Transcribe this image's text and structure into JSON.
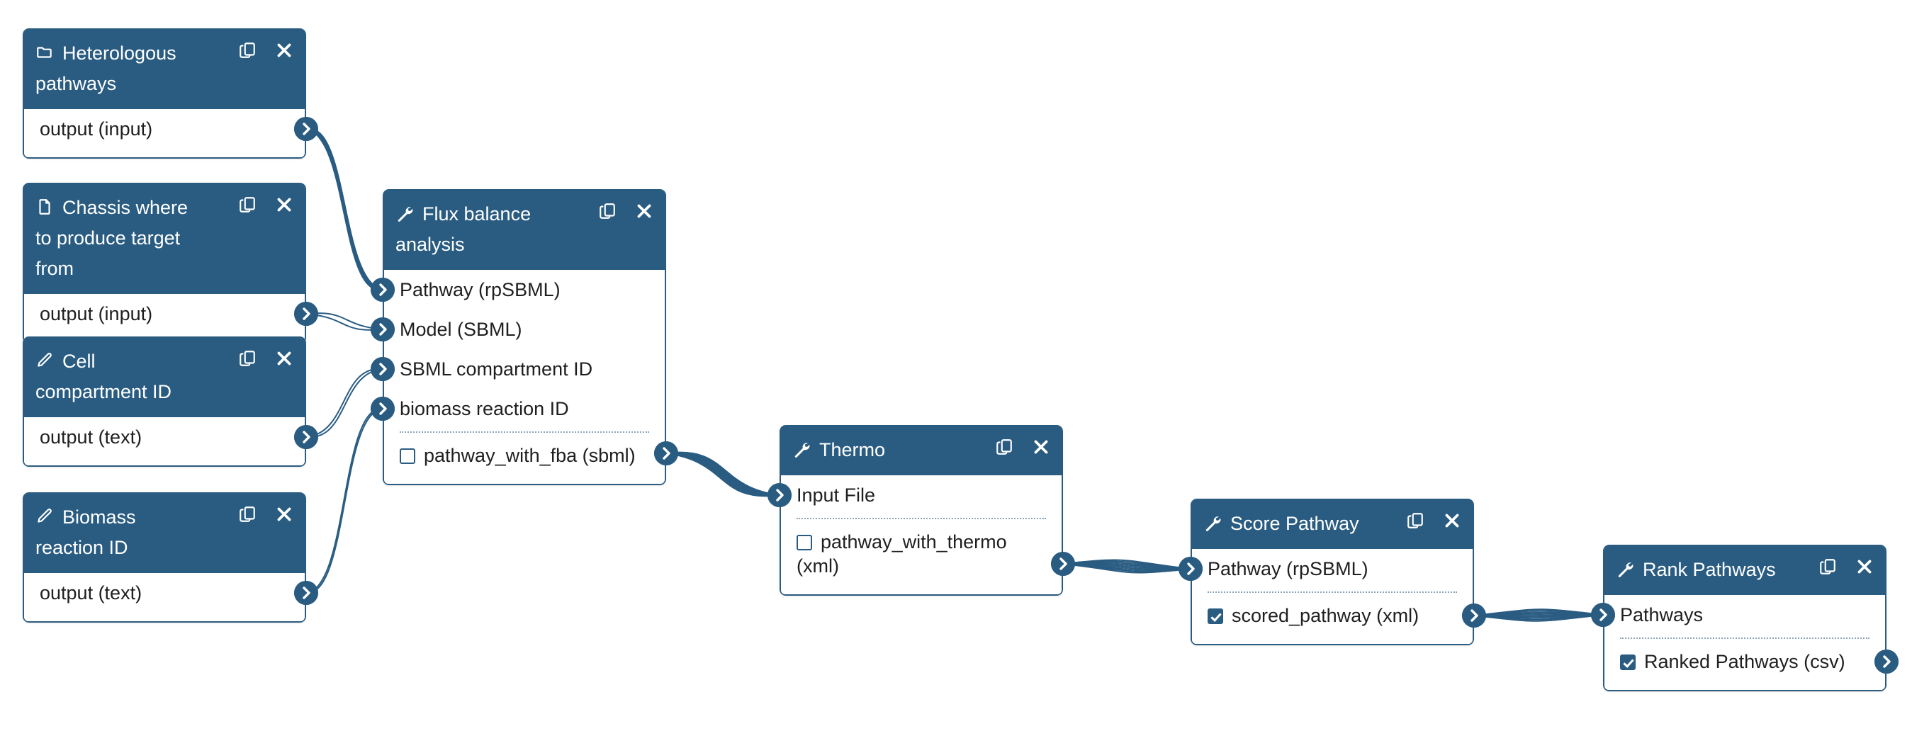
{
  "app": {
    "title": "Workflow Editor Canvas",
    "colors": {
      "node_header": "#2a5c82",
      "node_border": "#2a5c82",
      "node_body": "#ffffff",
      "edge": "#2a5c82",
      "port": "#2a5c82",
      "canvas": "#ffffff",
      "divider": "#8aa5ba"
    }
  },
  "nodes": [
    {
      "id": "heterologous-pathways",
      "title": "Heterologous pathways",
      "icon": "folder-icon",
      "kind": "input",
      "actions": {
        "copy": "copy-icon",
        "close": "close-icon"
      },
      "rows": [
        {
          "label": "output (input)",
          "type": "output",
          "checkbox": null
        }
      ]
    },
    {
      "id": "chassis-where-to-produce-target-from",
      "title": "Chassis where to produce target from",
      "icon": "file-icon",
      "kind": "input",
      "actions": {
        "copy": "copy-icon",
        "close": "close-icon"
      },
      "rows": [
        {
          "label": "output (input)",
          "type": "output",
          "checkbox": null
        }
      ]
    },
    {
      "id": "cell-compartment-id",
      "title": "Cell compartment ID",
      "icon": "pencil-icon",
      "kind": "parameter",
      "actions": {
        "copy": "copy-icon",
        "close": "close-icon"
      },
      "rows": [
        {
          "label": "output (text)",
          "type": "output",
          "checkbox": null
        }
      ]
    },
    {
      "id": "biomass-reaction-id",
      "title": "Biomass reaction ID",
      "icon": "pencil-icon",
      "kind": "parameter",
      "actions": {
        "copy": "copy-icon",
        "close": "close-icon"
      },
      "rows": [
        {
          "label": "output (text)",
          "type": "output",
          "checkbox": null
        }
      ]
    },
    {
      "id": "flux-balance-analysis",
      "title": "Flux balance analysis",
      "icon": "wrench-icon",
      "kind": "tool",
      "actions": {
        "copy": "copy-icon",
        "close": "close-icon"
      },
      "rows": [
        {
          "label": "Pathway (rpSBML)",
          "type": "input",
          "checkbox": null
        },
        {
          "label": "Model (SBML)",
          "type": "input",
          "checkbox": null
        },
        {
          "label": "SBML compartment ID",
          "type": "input",
          "checkbox": null
        },
        {
          "label": "biomass reaction ID",
          "type": "input",
          "checkbox": null
        },
        {
          "label": "pathway_with_fba (sbml)",
          "type": "output",
          "checkbox": "unchecked"
        }
      ]
    },
    {
      "id": "thermo",
      "title": "Thermo",
      "icon": "wrench-icon",
      "kind": "tool",
      "actions": {
        "copy": "copy-icon",
        "close": "close-icon"
      },
      "rows": [
        {
          "label": "Input File",
          "type": "input",
          "checkbox": null
        },
        {
          "label": "pathway_with_thermo (xml)",
          "type": "output",
          "checkbox": "unchecked"
        }
      ]
    },
    {
      "id": "score-pathway",
      "title": "Score Pathway",
      "icon": "wrench-icon",
      "kind": "tool",
      "actions": {
        "copy": "copy-icon",
        "close": "close-icon"
      },
      "rows": [
        {
          "label": "Pathway (rpSBML)",
          "type": "input",
          "checkbox": null
        },
        {
          "label": "scored_pathway (xml)",
          "type": "output",
          "checkbox": "checked"
        }
      ]
    },
    {
      "id": "rank-pathways",
      "title": "Rank Pathways",
      "icon": "wrench-icon",
      "kind": "tool",
      "actions": {
        "copy": "copy-icon",
        "close": "close-icon"
      },
      "rows": [
        {
          "label": "Pathways",
          "type": "input",
          "checkbox": null
        },
        {
          "label": "Ranked Pathways (csv)",
          "type": "output",
          "checkbox": "checked"
        }
      ]
    }
  ],
  "connections": [
    {
      "from": "heterologous-pathways.output (input)",
      "to": "flux-balance-analysis.Pathway (rpSBML)",
      "strands": 9
    },
    {
      "from": "chassis-where-to-produce-target-from.output (input)",
      "to": "flux-balance-analysis.Model (SBML)",
      "strands": 2
    },
    {
      "from": "cell-compartment-id.output (text)",
      "to": "flux-balance-analysis.SBML compartment ID",
      "strands": 2
    },
    {
      "from": "biomass-reaction-id.output (text)",
      "to": "flux-balance-analysis.biomass reaction ID",
      "strands": 2
    },
    {
      "from": "flux-balance-analysis.pathway_with_fba (sbml)",
      "to": "thermo.Input File",
      "strands": 9
    },
    {
      "from": "thermo.pathway_with_thermo (xml)",
      "to": "score-pathway.Pathway (rpSBML)",
      "strands": 9
    },
    {
      "from": "score-pathway.scored_pathway (xml)",
      "to": "rank-pathways.Pathways",
      "strands": 9
    }
  ]
}
